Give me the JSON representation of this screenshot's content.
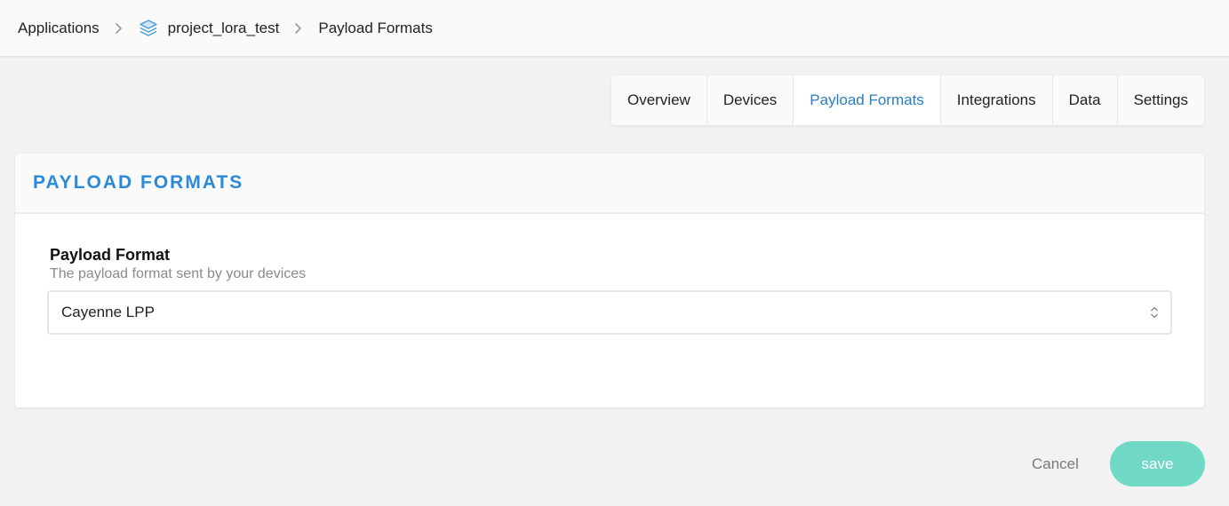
{
  "breadcrumb": {
    "root": "Applications",
    "application": "project_lora_test",
    "current": "Payload Formats",
    "app_icon": "layers-icon",
    "separator_icon": "chevron-right-icon"
  },
  "tabs": [
    {
      "label": "Overview",
      "active": false
    },
    {
      "label": "Devices",
      "active": false
    },
    {
      "label": "Payload Formats",
      "active": true
    },
    {
      "label": "Integrations",
      "active": false
    },
    {
      "label": "Data",
      "active": false
    },
    {
      "label": "Settings",
      "active": false
    }
  ],
  "card": {
    "title": "PAYLOAD FORMATS",
    "field": {
      "label": "Payload Format",
      "help": "The payload format sent by your devices",
      "selected_value": "Cayenne LPP",
      "arrow_icon": "updown-chevron-icon"
    }
  },
  "actions": {
    "cancel_label": "Cancel",
    "save_label": "save"
  },
  "colors": {
    "accent_blue": "#2b7ec1",
    "title_blue": "#2b8ad6",
    "save_green": "#70d9c6",
    "background": "#f2f2f2"
  }
}
